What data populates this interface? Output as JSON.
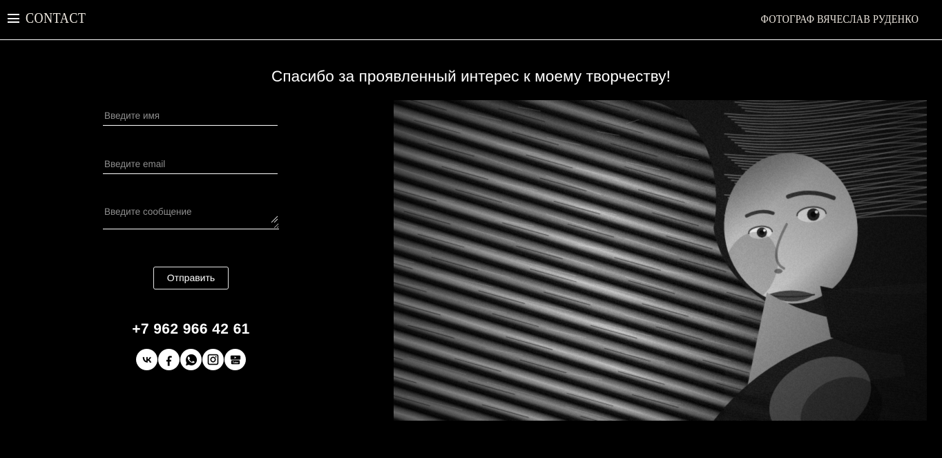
{
  "header": {
    "menu_icon": "hamburger-menu-icon",
    "menu_label": "CONTACT",
    "site_title": "ФОТОГРАФ ВЯЧЕСЛАВ РУДЕНКО"
  },
  "main": {
    "heading": "Спасибо за проявленный интерес к моему творчеству!"
  },
  "form": {
    "name": {
      "value": "",
      "placeholder": "Введите имя"
    },
    "email": {
      "value": "",
      "placeholder": "Введите email"
    },
    "message": {
      "value": "",
      "placeholder": "Введите сообщение"
    },
    "submit_label": "Отправить"
  },
  "contact": {
    "phone": "+7 962 966 42 61"
  },
  "social": [
    {
      "name": "vk-icon",
      "label": "VK"
    },
    {
      "name": "facebook-icon",
      "label": "Facebook"
    },
    {
      "name": "whatsapp-icon",
      "label": "WhatsApp"
    },
    {
      "name": "instagram-icon",
      "label": "Instagram"
    },
    {
      "name": "youtube-icon",
      "label": "YouTube"
    }
  ],
  "photo": {
    "alt": "Чёрно-белый портрет девушки на фоне гофрированного металла"
  },
  "colors": {
    "background": "#000000",
    "text": "#ffffff",
    "placeholder": "#8e8e8e",
    "rule": "#ffffff"
  }
}
